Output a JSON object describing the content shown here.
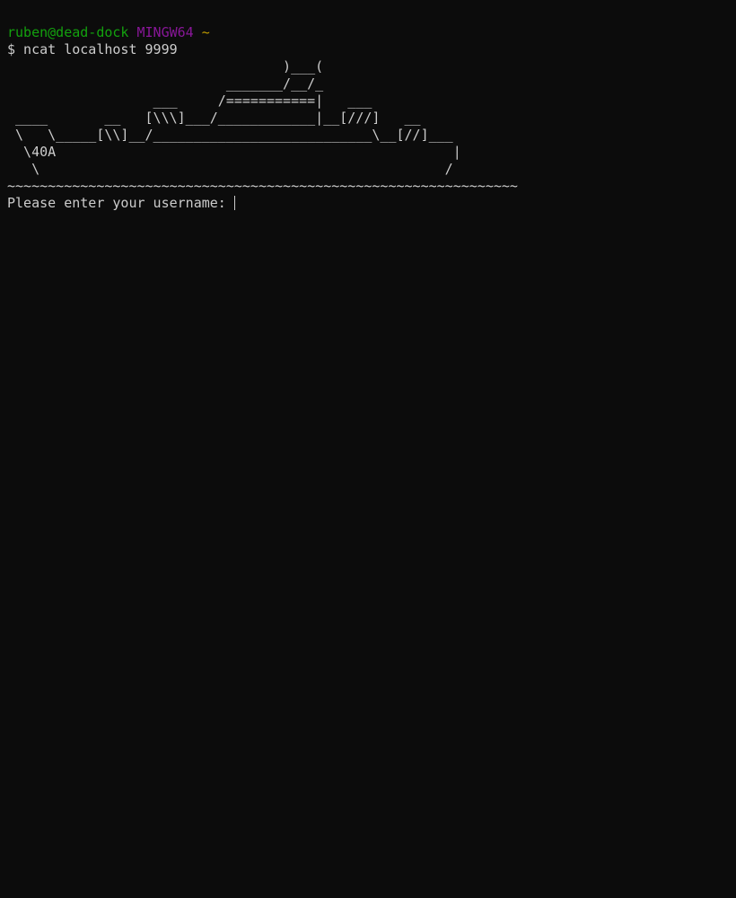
{
  "prompt": {
    "user_host": "ruben@dead-dock",
    "system": "MINGW64",
    "path": "~"
  },
  "command": {
    "text": "$ ncat localhost 9999"
  },
  "banner": {
    "lines": [
      "                                  )___(",
      "                           _______/__/_",
      "                  ___     /===========|   ___",
      " ____       __   [\\\\\\]___/____________|__[///]   __",
      " \\   \\_____[\\\\]__/___________________________\\__[//]___",
      "  \\40A                                                 |",
      "   \\                                                  /",
      "~~~~~~~~~~~~~~~~~~~~~~~~~~~~~~~~~~~~~~~~~~~~~~~~~~~~~~~~~~~~~~~"
    ]
  },
  "input_prompt": {
    "text": "Please enter your username: "
  },
  "colors": {
    "background": "#0c0c0c",
    "foreground": "#cccccc",
    "user_host": "#13a10e",
    "system": "#881798",
    "path": "#c19c00"
  }
}
